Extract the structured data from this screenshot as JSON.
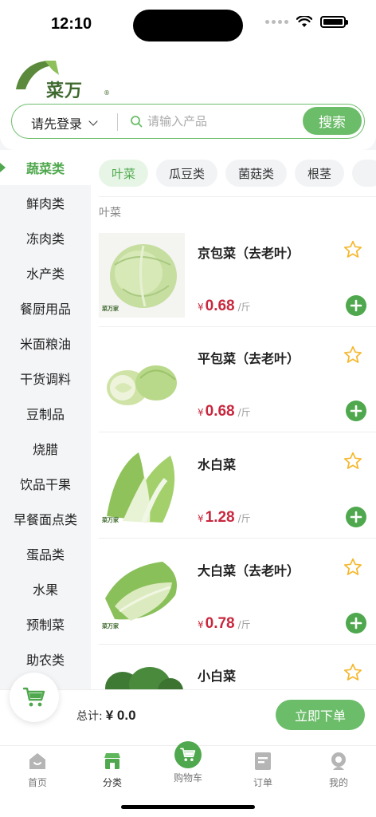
{
  "status": {
    "time": "12:10"
  },
  "brand": {
    "logo_text": "菜万家",
    "reg_mark": "®"
  },
  "search": {
    "login_label": "请先登录",
    "placeholder": "请输入产品",
    "button_label": "搜索"
  },
  "sidebar": {
    "items": [
      {
        "label": "蔬菜类",
        "active": true
      },
      {
        "label": "鲜肉类"
      },
      {
        "label": "冻肉类"
      },
      {
        "label": "水产类"
      },
      {
        "label": "餐厨用品"
      },
      {
        "label": "米面粮油"
      },
      {
        "label": "干货调料"
      },
      {
        "label": "豆制品"
      },
      {
        "label": "烧腊"
      },
      {
        "label": "饮品干果"
      },
      {
        "label": "早餐面点类"
      },
      {
        "label": "蛋品类"
      },
      {
        "label": "水果"
      },
      {
        "label": "预制菜"
      },
      {
        "label": "助农类"
      }
    ]
  },
  "sub_tabs": [
    {
      "label": "叶菜",
      "active": true
    },
    {
      "label": "瓜豆类"
    },
    {
      "label": "菌菇类"
    },
    {
      "label": "根茎"
    }
  ],
  "section_label": "叶菜",
  "products": [
    {
      "name": "京包菜（去老叶）",
      "currency": "¥",
      "price": "0.68",
      "unit": "/斤",
      "watermark": "菜万家"
    },
    {
      "name": "平包菜（去老叶）",
      "currency": "¥",
      "price": "0.68",
      "unit": "/斤"
    },
    {
      "name": "水白菜",
      "currency": "¥",
      "price": "1.28",
      "unit": "/斤",
      "watermark": "菜万家"
    },
    {
      "name": "大白菜（去老叶）",
      "currency": "¥",
      "price": "0.78",
      "unit": "/斤",
      "watermark": "菜万家"
    },
    {
      "name": "小白菜"
    }
  ],
  "cart": {
    "total_label": "总计:",
    "total_value": "¥ 0.0",
    "order_button": "立即下单"
  },
  "tabbar": [
    {
      "label": "首页",
      "icon": "home-icon"
    },
    {
      "label": "分类",
      "icon": "category-icon",
      "active": true
    },
    {
      "label": "购物车",
      "icon": "cart-icon"
    },
    {
      "label": "订单",
      "icon": "order-icon"
    },
    {
      "label": "我的",
      "icon": "profile-icon"
    }
  ],
  "colors": {
    "accent": "#6cbd6a",
    "price": "#c8283e",
    "star": "#f5b82e",
    "brand": "#3f6a2f"
  }
}
